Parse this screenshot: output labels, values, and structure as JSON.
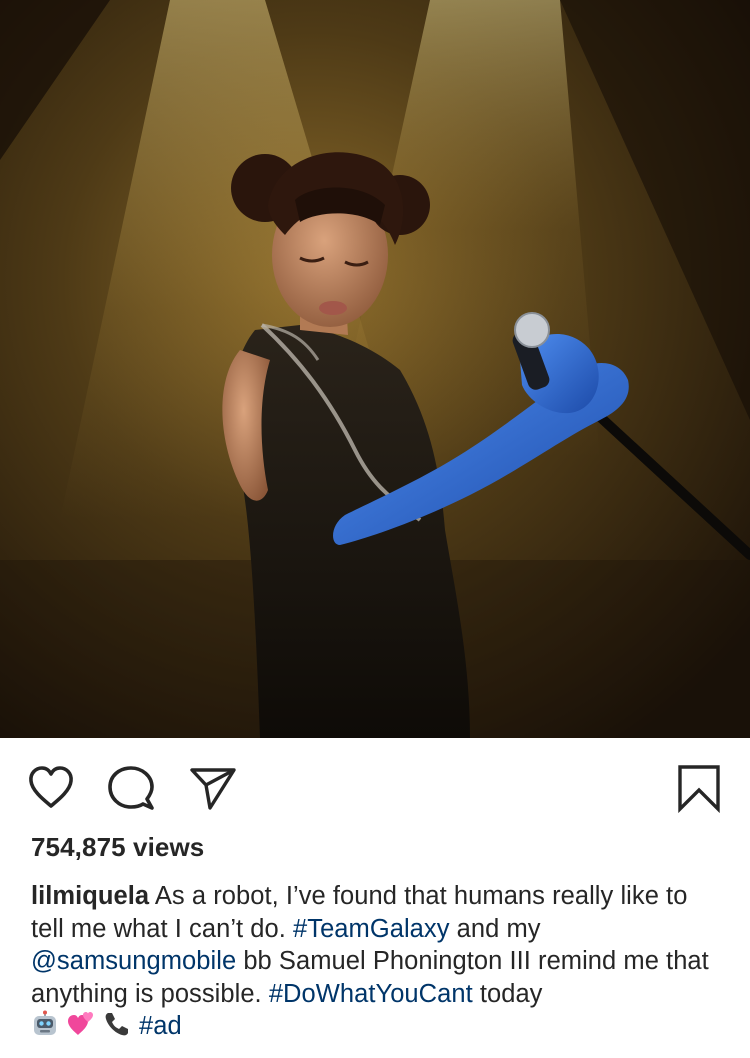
{
  "media": {
    "icon": "photo-singer-on-stage",
    "colors": {
      "background_dark": "#1f1408",
      "spotlight": "#e8c868",
      "glove": "#2f6bd6"
    }
  },
  "actions": {
    "like_icon": "heart-icon",
    "comment_icon": "comment-icon",
    "share_icon": "paper-plane-icon",
    "save_icon": "bookmark-icon"
  },
  "stats": {
    "views": "754,875 views"
  },
  "caption": {
    "username": "lilmiquela",
    "text_1": " As a robot, I’ve found that humans really like to tell me what I can’t do. ",
    "hashtag_1": "#TeamGalaxy",
    "text_2": " and my ",
    "mention": "@samsungmobile",
    "text_3": " bb Samuel Phonington III remind me that anything is possible. ",
    "hashtag_2": "#DoWhatYouCant",
    "text_4": " today ",
    "emojis": [
      "robot-face-emoji",
      "two-hearts-emoji",
      "telephone-receiver-emoji"
    ],
    "hashtag_3": "#ad"
  },
  "colors": {
    "text": "#262626",
    "link": "#003569"
  }
}
